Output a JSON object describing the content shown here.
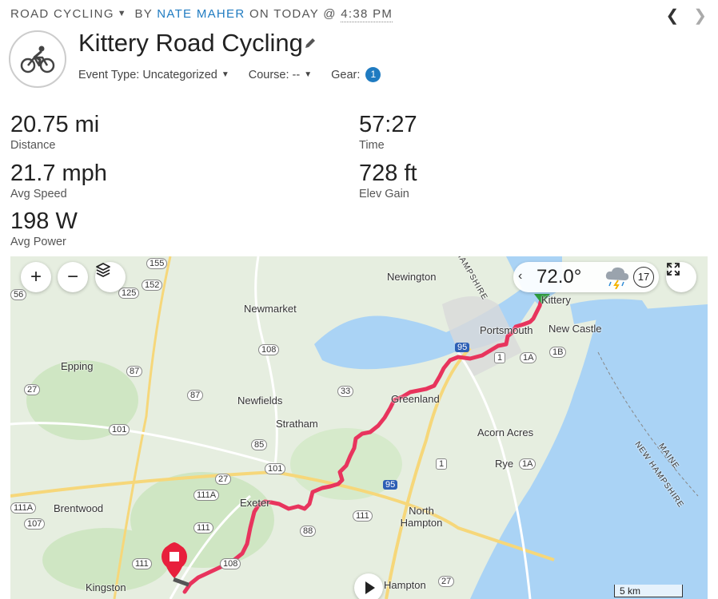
{
  "header": {
    "activity_type": "ROAD CYCLING",
    "by_prefix": "BY",
    "author": "NATE MAHER",
    "on_prefix": "ON TODAY @",
    "time": "4:38 PM",
    "prev_icon": "chevron-left-icon",
    "next_icon": "chevron-right-icon"
  },
  "activity": {
    "icon": "cyclist-icon",
    "title": "Kittery Road Cycling",
    "edit_icon": "pencil-icon",
    "event_type_label": "Event Type: Uncategorized",
    "course_label": "Course: --",
    "gear_label": "Gear:",
    "gear_count": "1"
  },
  "stats": [
    {
      "value": "20.75 mi",
      "label": "Distance"
    },
    {
      "value": "57:27",
      "label": "Time"
    },
    {
      "value": "21.7 mph",
      "label": "Avg Speed"
    },
    {
      "value": "728 ft",
      "label": "Elev Gain"
    },
    {
      "value": "198 W",
      "label": "Avg Power"
    }
  ],
  "map": {
    "zoom_in": "+",
    "zoom_out": "−",
    "layers_icon": "layers-icon",
    "fullscreen_icon": "expand-icon",
    "weather": {
      "temp": "72.0°",
      "icon": "thunderstorm-icon",
      "wind": "17"
    },
    "scale": "5 km",
    "places": [
      "Newington",
      "Newmarket",
      "Kittery",
      "Portsmouth",
      "New Castle",
      "Epping",
      "Greenland",
      "Newfields",
      "Stratham",
      "Acorn Acres",
      "Rye",
      "Exeter",
      "North Hampton",
      "Brentwood",
      "Kingston",
      "Hampton",
      "MAINE",
      "NEW HAMPSHIRE",
      "NEW HAMPSHIRE"
    ],
    "routes": [
      "155",
      "152",
      "125",
      "108",
      "87",
      "27",
      "87",
      "101",
      "85",
      "101",
      "27",
      "111A",
      "111",
      "88",
      "111",
      "111A",
      "107",
      "111",
      "108",
      "33",
      "95",
      "1",
      "1A",
      "1B",
      "1",
      "1A",
      "95",
      "27",
      "101",
      "108",
      "56",
      "1B"
    ],
    "colors": {
      "route": "#e8345d",
      "water": "#aad3f5",
      "land": "#e6eee0",
      "road": "#f6d77a"
    }
  }
}
